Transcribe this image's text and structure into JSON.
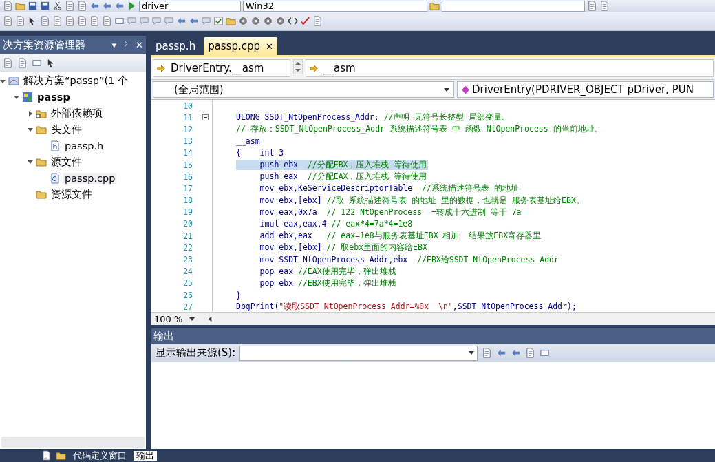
{
  "toolbar": {
    "config": "driver",
    "platform": "Win32"
  },
  "solution_explorer": {
    "title": "决方案资源管理器",
    "menu": "▾",
    "pin": "ᚹ",
    "close": "✕",
    "tree": [
      {
        "label": "解决方案“passp”(1 个",
        "kind": "solution",
        "expanded": true,
        "selected": false,
        "children": [
          {
            "label": "passp",
            "kind": "project",
            "expanded": true,
            "selected": false,
            "children": [
              {
                "label": "外部依赖项",
                "kind": "deps",
                "expanded": false,
                "selected": false
              },
              {
                "label": "头文件",
                "kind": "folder",
                "expanded": true,
                "selected": false,
                "children": [
                  {
                    "label": "passp.h",
                    "kind": "header",
                    "selected": false
                  }
                ]
              },
              {
                "label": "源文件",
                "kind": "folder",
                "expanded": true,
                "selected": false,
                "children": [
                  {
                    "label": "passp.cpp",
                    "kind": "source",
                    "selected": true
                  }
                ]
              },
              {
                "label": "资源文件",
                "kind": "folder",
                "selected": false
              }
            ]
          }
        ]
      }
    ]
  },
  "editor": {
    "tabs": [
      {
        "label": "passp.h",
        "selected": false
      },
      {
        "label": "passp.cpp",
        "selected": true,
        "close": "✕"
      }
    ],
    "nav_left": "DriverEntry.__asm",
    "nav_right": "__asm",
    "scope": "(全局范围)",
    "member": "DriverEntry(PDRIVER_OBJECT pDriver, PUN",
    "lines": [
      {
        "number": "10",
        "selected": false
      },
      {
        "number": "11",
        "selected": false,
        "fold": true,
        "segments": [
          {
            "kind": "code",
            "text": "ULONG SSDT_NtOpenProcess_Addr; "
          },
          {
            "kind": "comment",
            "text": "//声明 无符号长整型 局部变量。"
          }
        ]
      },
      {
        "number": "12",
        "selected": false,
        "segments": [
          {
            "kind": "comment",
            "text": "// 存放：SSDT_NtOpenProcess_Addr 系统描述符号表 中 函数 NtOpenProcess 的当前地址。"
          }
        ]
      },
      {
        "number": "13",
        "selected": false,
        "segments": [
          {
            "kind": "code",
            "text": "__asm"
          }
        ]
      },
      {
        "number": "14",
        "selected": false,
        "segments": [
          {
            "kind": "code",
            "text": "{    int 3"
          }
        ]
      },
      {
        "number": "15",
        "selected": true,
        "segments": [
          {
            "kind": "code",
            "text": "     push ebx  "
          },
          {
            "kind": "comment",
            "text": "//分配EBX，压入堆栈 等待使用"
          }
        ]
      },
      {
        "number": "16",
        "selected": false,
        "segments": [
          {
            "kind": "code",
            "text": "     push eax  "
          },
          {
            "kind": "comment",
            "text": "//分配EAX，压入堆栈 等待使用"
          }
        ]
      },
      {
        "number": "17",
        "selected": false,
        "segments": [
          {
            "kind": "code",
            "text": "     mov ebx,KeServiceDescriptorTable  "
          },
          {
            "kind": "comment",
            "text": "//系统描述符号表 的地址"
          }
        ]
      },
      {
        "number": "18",
        "selected": false,
        "segments": [
          {
            "kind": "code",
            "text": "     mov ebx,[ebx] "
          },
          {
            "kind": "comment",
            "text": "//取 系统描述符号表 的地址 里的数据，也就是 服务表基址给EBX。"
          }
        ]
      },
      {
        "number": "19",
        "selected": false,
        "segments": [
          {
            "kind": "code",
            "text": "     mov eax,0x7a  "
          },
          {
            "kind": "comment",
            "text": "// 122 NtOpenProcess  =转成十六进制 等于 7a"
          }
        ]
      },
      {
        "number": "20",
        "selected": false,
        "segments": [
          {
            "kind": "code",
            "text": "     imul eax,eax,4 "
          },
          {
            "kind": "comment",
            "text": "// eax*4=7a*4=1e8"
          }
        ]
      },
      {
        "number": "21",
        "selected": false,
        "segments": [
          {
            "kind": "code",
            "text": "     add ebx,eax   "
          },
          {
            "kind": "comment",
            "text": "// eax=1e8与服务表基址EBX 相加  结果放EBX寄存器里"
          }
        ]
      },
      {
        "number": "22",
        "selected": false,
        "segments": [
          {
            "kind": "code",
            "text": "     mov ebx,[ebx] "
          },
          {
            "kind": "comment",
            "text": "// 取ebx里面的内容给EBX"
          }
        ]
      },
      {
        "number": "23",
        "selected": false,
        "segments": [
          {
            "kind": "code",
            "text": "     mov SSDT_NtOpenProcess_Addr,ebx  "
          },
          {
            "kind": "comment",
            "text": "//EBX给SSDT_NtOpenProcess_Addr"
          }
        ]
      },
      {
        "number": "24",
        "selected": false,
        "segments": [
          {
            "kind": "code",
            "text": "     pop eax "
          },
          {
            "kind": "comment",
            "text": "//EAX使用完毕，弹出堆栈"
          }
        ]
      },
      {
        "number": "25",
        "selected": false,
        "segments": [
          {
            "kind": "code",
            "text": "     pop ebx "
          },
          {
            "kind": "comment",
            "text": "//EBX使用完毕，弹出堆栈"
          }
        ]
      },
      {
        "number": "26",
        "selected": false,
        "segments": [
          {
            "kind": "code",
            "text": "}"
          }
        ]
      },
      {
        "number": "27",
        "selected": false,
        "segments": [
          {
            "kind": "code",
            "text": "DbgPrint("
          },
          {
            "kind": "string",
            "text": "\"读取SSDT_NtOpenProcess_Addr=%0x  \\n\""
          },
          {
            "kind": "code",
            "text": ",SSDT_NtOpenProcess_Addr);"
          }
        ]
      }
    ],
    "zoom": "100 %"
  },
  "output": {
    "title": "输出",
    "source_label": "显示输出来源(S):"
  },
  "bottom_tabs": [
    {
      "label": "代码定义窗口",
      "selected": false
    },
    {
      "label": "输出",
      "selected": true
    }
  ]
}
